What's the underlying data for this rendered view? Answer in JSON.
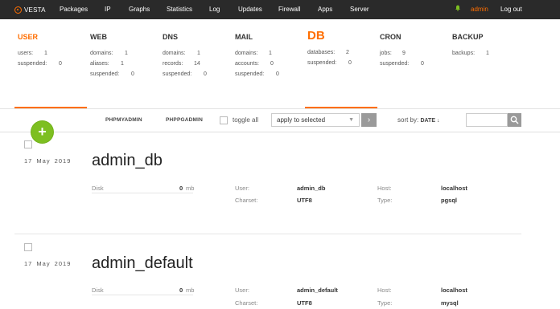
{
  "topbar": {
    "logo": "VESTA",
    "nav": [
      "Packages",
      "IP",
      "Graphs",
      "Statistics",
      "Log",
      "Updates",
      "Firewall",
      "Apps",
      "Server"
    ],
    "user": "admin",
    "logout": "Log out"
  },
  "stats": [
    {
      "title": "USER",
      "rows": [
        [
          "users:",
          "1"
        ],
        [
          "suspended:",
          "0"
        ]
      ]
    },
    {
      "title": "WEB",
      "rows": [
        [
          "domains:",
          "1"
        ],
        [
          "aliases:",
          "1"
        ],
        [
          "suspended:",
          "0"
        ]
      ]
    },
    {
      "title": "DNS",
      "rows": [
        [
          "domains:",
          "1"
        ],
        [
          "records:",
          "14"
        ],
        [
          "suspended:",
          "0"
        ]
      ]
    },
    {
      "title": "MAIL",
      "rows": [
        [
          "domains:",
          "1"
        ],
        [
          "accounts:",
          "0"
        ],
        [
          "suspended:",
          "0"
        ]
      ]
    },
    {
      "title": "DB",
      "rows": [
        [
          "databases:",
          "2"
        ],
        [
          "suspended:",
          "0"
        ]
      ]
    },
    {
      "title": "CRON",
      "rows": [
        [
          "jobs:",
          "9"
        ],
        [
          "suspended:",
          "0"
        ]
      ]
    },
    {
      "title": "BACKUP",
      "rows": [
        [
          "backups:",
          "1"
        ]
      ]
    }
  ],
  "toolbar": {
    "phpmyadmin": "PHPMYADMIN",
    "phppgadmin": "PHPPGADMIN",
    "toggle_all": "toggle all",
    "apply_selected": "apply to selected",
    "sort_by": "sort by:",
    "sort_field": "DATE ↓"
  },
  "labels": {
    "disk": "Disk",
    "user": "User:",
    "charset": "Charset:",
    "host": "Host:",
    "type": "Type:",
    "mb": "mb"
  },
  "databases": [
    {
      "date": "17 May 2019",
      "name": "admin_db",
      "disk": "0",
      "user": "admin_db",
      "charset": "UTF8",
      "host": "localhost",
      "type": "pgsql"
    },
    {
      "date": "17 May 2019",
      "name": "admin_default",
      "disk": "0",
      "user": "admin_default",
      "charset": "UTF8",
      "host": "localhost",
      "type": "mysql"
    }
  ]
}
